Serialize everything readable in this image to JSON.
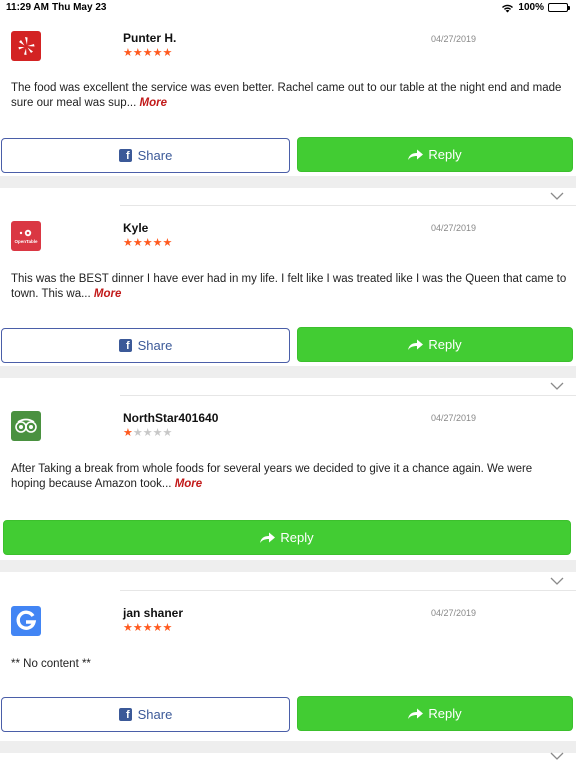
{
  "status_bar": {
    "time": "11:29 AM",
    "date": "Thu May 23",
    "battery": "100%"
  },
  "reviews": [
    {
      "source": "yelp-icon",
      "author": "Punter H.",
      "date": "04/27/2019",
      "rating": 5,
      "text": "The food was excellent the service was even better. Rachel came out to our table at the night end and made sure our meal was sup...",
      "more": "More",
      "share_label": "Share",
      "reply_label": "Reply"
    },
    {
      "source": "opentable-icon",
      "logo_text": "OpenTable",
      "author": "Kyle",
      "date": "04/27/2019",
      "rating": 5,
      "text": "This was the BEST dinner I have ever had in my life. I felt like I was treated like I was the Queen that came to town. This wa...",
      "more": "More",
      "share_label": "Share",
      "reply_label": "Reply"
    },
    {
      "source": "tripadvisor-icon",
      "author": "NorthStar401640",
      "date": "04/27/2019",
      "rating": 1,
      "text": "After Taking a break from whole foods for several years we decided to give it a chance again. We were hoping because Amazon took...",
      "more": "More",
      "reply_label": "Reply"
    },
    {
      "source": "google-icon",
      "author": "jan shaner",
      "date": "04/27/2019",
      "rating": 5,
      "text": "** No content **",
      "share_label": "Share",
      "reply_label": "Reply"
    }
  ],
  "colors": {
    "accent_green": "#42cc33",
    "facebook_blue": "#3b5998",
    "star": "#ff5a1f",
    "more_link": "#c21a1a"
  }
}
